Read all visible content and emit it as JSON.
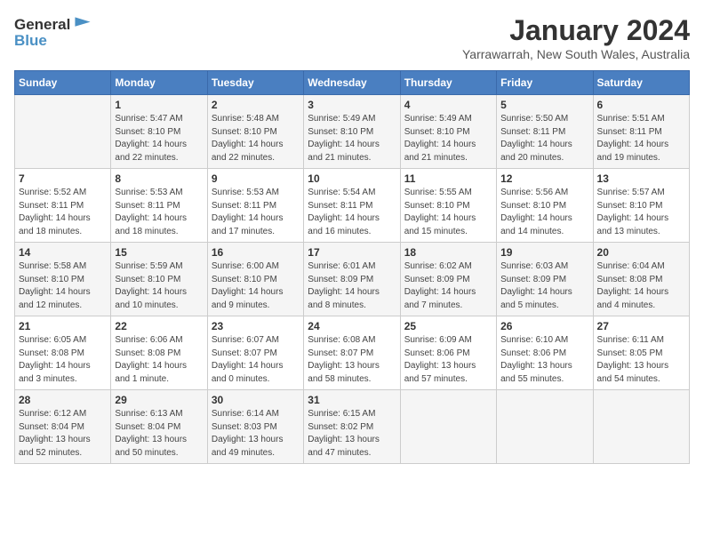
{
  "header": {
    "logo_general": "General",
    "logo_blue": "Blue",
    "title": "January 2024",
    "subtitle": "Yarrawarrah, New South Wales, Australia"
  },
  "days_of_week": [
    "Sunday",
    "Monday",
    "Tuesday",
    "Wednesday",
    "Thursday",
    "Friday",
    "Saturday"
  ],
  "weeks": [
    [
      {
        "day": "",
        "info": ""
      },
      {
        "day": "1",
        "info": "Sunrise: 5:47 AM\nSunset: 8:10 PM\nDaylight: 14 hours\nand 22 minutes."
      },
      {
        "day": "2",
        "info": "Sunrise: 5:48 AM\nSunset: 8:10 PM\nDaylight: 14 hours\nand 22 minutes."
      },
      {
        "day": "3",
        "info": "Sunrise: 5:49 AM\nSunset: 8:10 PM\nDaylight: 14 hours\nand 21 minutes."
      },
      {
        "day": "4",
        "info": "Sunrise: 5:49 AM\nSunset: 8:10 PM\nDaylight: 14 hours\nand 21 minutes."
      },
      {
        "day": "5",
        "info": "Sunrise: 5:50 AM\nSunset: 8:11 PM\nDaylight: 14 hours\nand 20 minutes."
      },
      {
        "day": "6",
        "info": "Sunrise: 5:51 AM\nSunset: 8:11 PM\nDaylight: 14 hours\nand 19 minutes."
      }
    ],
    [
      {
        "day": "7",
        "info": "Sunrise: 5:52 AM\nSunset: 8:11 PM\nDaylight: 14 hours\nand 18 minutes."
      },
      {
        "day": "8",
        "info": "Sunrise: 5:53 AM\nSunset: 8:11 PM\nDaylight: 14 hours\nand 18 minutes."
      },
      {
        "day": "9",
        "info": "Sunrise: 5:53 AM\nSunset: 8:11 PM\nDaylight: 14 hours\nand 17 minutes."
      },
      {
        "day": "10",
        "info": "Sunrise: 5:54 AM\nSunset: 8:11 PM\nDaylight: 14 hours\nand 16 minutes."
      },
      {
        "day": "11",
        "info": "Sunrise: 5:55 AM\nSunset: 8:10 PM\nDaylight: 14 hours\nand 15 minutes."
      },
      {
        "day": "12",
        "info": "Sunrise: 5:56 AM\nSunset: 8:10 PM\nDaylight: 14 hours\nand 14 minutes."
      },
      {
        "day": "13",
        "info": "Sunrise: 5:57 AM\nSunset: 8:10 PM\nDaylight: 14 hours\nand 13 minutes."
      }
    ],
    [
      {
        "day": "14",
        "info": "Sunrise: 5:58 AM\nSunset: 8:10 PM\nDaylight: 14 hours\nand 12 minutes."
      },
      {
        "day": "15",
        "info": "Sunrise: 5:59 AM\nSunset: 8:10 PM\nDaylight: 14 hours\nand 10 minutes."
      },
      {
        "day": "16",
        "info": "Sunrise: 6:00 AM\nSunset: 8:10 PM\nDaylight: 14 hours\nand 9 minutes."
      },
      {
        "day": "17",
        "info": "Sunrise: 6:01 AM\nSunset: 8:09 PM\nDaylight: 14 hours\nand 8 minutes."
      },
      {
        "day": "18",
        "info": "Sunrise: 6:02 AM\nSunset: 8:09 PM\nDaylight: 14 hours\nand 7 minutes."
      },
      {
        "day": "19",
        "info": "Sunrise: 6:03 AM\nSunset: 8:09 PM\nDaylight: 14 hours\nand 5 minutes."
      },
      {
        "day": "20",
        "info": "Sunrise: 6:04 AM\nSunset: 8:08 PM\nDaylight: 14 hours\nand 4 minutes."
      }
    ],
    [
      {
        "day": "21",
        "info": "Sunrise: 6:05 AM\nSunset: 8:08 PM\nDaylight: 14 hours\nand 3 minutes."
      },
      {
        "day": "22",
        "info": "Sunrise: 6:06 AM\nSunset: 8:08 PM\nDaylight: 14 hours\nand 1 minute."
      },
      {
        "day": "23",
        "info": "Sunrise: 6:07 AM\nSunset: 8:07 PM\nDaylight: 14 hours\nand 0 minutes."
      },
      {
        "day": "24",
        "info": "Sunrise: 6:08 AM\nSunset: 8:07 PM\nDaylight: 13 hours\nand 58 minutes."
      },
      {
        "day": "25",
        "info": "Sunrise: 6:09 AM\nSunset: 8:06 PM\nDaylight: 13 hours\nand 57 minutes."
      },
      {
        "day": "26",
        "info": "Sunrise: 6:10 AM\nSunset: 8:06 PM\nDaylight: 13 hours\nand 55 minutes."
      },
      {
        "day": "27",
        "info": "Sunrise: 6:11 AM\nSunset: 8:05 PM\nDaylight: 13 hours\nand 54 minutes."
      }
    ],
    [
      {
        "day": "28",
        "info": "Sunrise: 6:12 AM\nSunset: 8:04 PM\nDaylight: 13 hours\nand 52 minutes."
      },
      {
        "day": "29",
        "info": "Sunrise: 6:13 AM\nSunset: 8:04 PM\nDaylight: 13 hours\nand 50 minutes."
      },
      {
        "day": "30",
        "info": "Sunrise: 6:14 AM\nSunset: 8:03 PM\nDaylight: 13 hours\nand 49 minutes."
      },
      {
        "day": "31",
        "info": "Sunrise: 6:15 AM\nSunset: 8:02 PM\nDaylight: 13 hours\nand 47 minutes."
      },
      {
        "day": "",
        "info": ""
      },
      {
        "day": "",
        "info": ""
      },
      {
        "day": "",
        "info": ""
      }
    ]
  ]
}
